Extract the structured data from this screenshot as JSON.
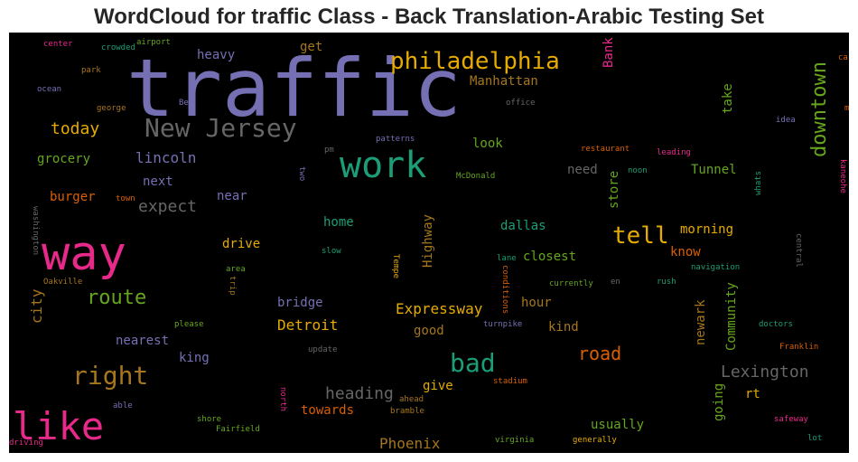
{
  "chart_data": {
    "type": "wordcloud",
    "title": "WordCloud for traffic Class - Back Translation-Arabic Testing Set",
    "background": "#000000",
    "words": [
      {
        "text": "traffic",
        "color": "#7570b3"
      },
      {
        "text": "way",
        "color": "#e7298a"
      },
      {
        "text": "like",
        "color": "#e7298a"
      },
      {
        "text": "work",
        "color": "#1b9e77"
      },
      {
        "text": "New Jersey",
        "color": "#666666"
      },
      {
        "text": "philadelphia",
        "color": "#e6ab02"
      },
      {
        "text": "right",
        "color": "#a6761d"
      },
      {
        "text": "bad",
        "color": "#1b9e77"
      },
      {
        "text": "tell",
        "color": "#e6ab02"
      },
      {
        "text": "route",
        "color": "#66a61e"
      },
      {
        "text": "downtown",
        "color": "#66a61e"
      },
      {
        "text": "today",
        "color": "#e6ab02"
      },
      {
        "text": "road",
        "color": "#d95f02"
      },
      {
        "text": "heading",
        "color": "#666666"
      },
      {
        "text": "Lexington",
        "color": "#666666"
      },
      {
        "text": "expect",
        "color": "#666666"
      },
      {
        "text": "lincoln",
        "color": "#7570b3"
      },
      {
        "text": "Expressway",
        "color": "#e6ab02"
      },
      {
        "text": "Detroit",
        "color": "#e6ab02"
      },
      {
        "text": "Phoenix",
        "color": "#a6761d"
      },
      {
        "text": "city",
        "color": "#a6761d"
      },
      {
        "text": "Manhattan",
        "color": "#a6761d"
      },
      {
        "text": "heavy",
        "color": "#7570b3"
      },
      {
        "text": "get",
        "color": "#a6761d"
      },
      {
        "text": "Bank",
        "color": "#e7298a"
      },
      {
        "text": "take",
        "color": "#66a61e"
      },
      {
        "text": "grocery",
        "color": "#66a61e"
      },
      {
        "text": "look",
        "color": "#66a61e"
      },
      {
        "text": "next",
        "color": "#7570b3"
      },
      {
        "text": "need",
        "color": "#666666"
      },
      {
        "text": "store",
        "color": "#66a61e"
      },
      {
        "text": "Tunnel",
        "color": "#66a61e"
      },
      {
        "text": "burger",
        "color": "#d95f02"
      },
      {
        "text": "near",
        "color": "#7570b3"
      },
      {
        "text": "home",
        "color": "#1b9e77"
      },
      {
        "text": "Highway",
        "color": "#a6761d"
      },
      {
        "text": "dallas",
        "color": "#1b9e77"
      },
      {
        "text": "morning",
        "color": "#e6ab02"
      },
      {
        "text": "drive",
        "color": "#e6ab02"
      },
      {
        "text": "know",
        "color": "#d95f02"
      },
      {
        "text": "closest",
        "color": "#66a61e"
      },
      {
        "text": "newark",
        "color": "#a6761d"
      },
      {
        "text": "Community",
        "color": "#66a61e"
      },
      {
        "text": "hour",
        "color": "#a6761d"
      },
      {
        "text": "bridge",
        "color": "#7570b3"
      },
      {
        "text": "kind",
        "color": "#a6761d"
      },
      {
        "text": "nearest",
        "color": "#7570b3"
      },
      {
        "text": "good",
        "color": "#a6761d"
      },
      {
        "text": "king",
        "color": "#7570b3"
      },
      {
        "text": "give",
        "color": "#e6ab02"
      },
      {
        "text": "rt",
        "color": "#e6ab02"
      },
      {
        "text": "going",
        "color": "#66a61e"
      },
      {
        "text": "towards",
        "color": "#d95f02"
      },
      {
        "text": "usually",
        "color": "#66a61e"
      },
      {
        "text": "center",
        "color": "#e7298a"
      },
      {
        "text": "crowded",
        "color": "#1b9e77"
      },
      {
        "text": "airport",
        "color": "#66a61e"
      },
      {
        "text": "park",
        "color": "#a6761d"
      },
      {
        "text": "ocean",
        "color": "#7570b3"
      },
      {
        "text": "george",
        "color": "#a6761d"
      },
      {
        "text": "Ben",
        "color": "#7570b3"
      },
      {
        "text": "office",
        "color": "#666666"
      },
      {
        "text": "cars",
        "color": "#d95f02"
      },
      {
        "text": "mall",
        "color": "#d95f02"
      },
      {
        "text": "idea",
        "color": "#7570b3"
      },
      {
        "text": "pm",
        "color": "#666666"
      },
      {
        "text": "patterns",
        "color": "#7570b3"
      },
      {
        "text": "restaurant",
        "color": "#d95f02"
      },
      {
        "text": "leading",
        "color": "#e7298a"
      },
      {
        "text": "kaneohe",
        "color": "#e7298a"
      },
      {
        "text": "two",
        "color": "#7570b3"
      },
      {
        "text": "McDonald",
        "color": "#66a61e"
      },
      {
        "text": "noon",
        "color": "#1b9e77"
      },
      {
        "text": "town",
        "color": "#d95f02"
      },
      {
        "text": "washington",
        "color": "#666666"
      },
      {
        "text": "whats",
        "color": "#1b9e77"
      },
      {
        "text": "slow",
        "color": "#1b9e77"
      },
      {
        "text": "Tempe",
        "color": "#e6ab02"
      },
      {
        "text": "lane",
        "color": "#1b9e77"
      },
      {
        "text": "central",
        "color": "#666666"
      },
      {
        "text": "area",
        "color": "#66a61e"
      },
      {
        "text": "navigation",
        "color": "#1b9e77"
      },
      {
        "text": "Oakville",
        "color": "#a6761d"
      },
      {
        "text": "trip",
        "color": "#a6761d"
      },
      {
        "text": "conditions",
        "color": "#d95f02"
      },
      {
        "text": "currently",
        "color": "#66a61e"
      },
      {
        "text": "en",
        "color": "#666666"
      },
      {
        "text": "rush",
        "color": "#1b9e77"
      },
      {
        "text": "please",
        "color": "#66a61e"
      },
      {
        "text": "turnpike",
        "color": "#7570b3"
      },
      {
        "text": "doctors",
        "color": "#1b9e77"
      },
      {
        "text": "update",
        "color": "#666666"
      },
      {
        "text": "Franklin",
        "color": "#d95f02"
      },
      {
        "text": "stadium",
        "color": "#d95f02"
      },
      {
        "text": "able",
        "color": "#7570b3"
      },
      {
        "text": "ahead",
        "color": "#a6761d"
      },
      {
        "text": "north",
        "color": "#e7298a"
      },
      {
        "text": "bramble",
        "color": "#a6761d"
      },
      {
        "text": "shore",
        "color": "#66a61e"
      },
      {
        "text": "Fairfield",
        "color": "#66a61e"
      },
      {
        "text": "safeway",
        "color": "#e7298a"
      },
      {
        "text": "driving",
        "color": "#e7298a"
      },
      {
        "text": "virginia",
        "color": "#66a61e"
      },
      {
        "text": "generally",
        "color": "#e6ab02"
      },
      {
        "text": "lot",
        "color": "#1b9e77"
      }
    ]
  }
}
